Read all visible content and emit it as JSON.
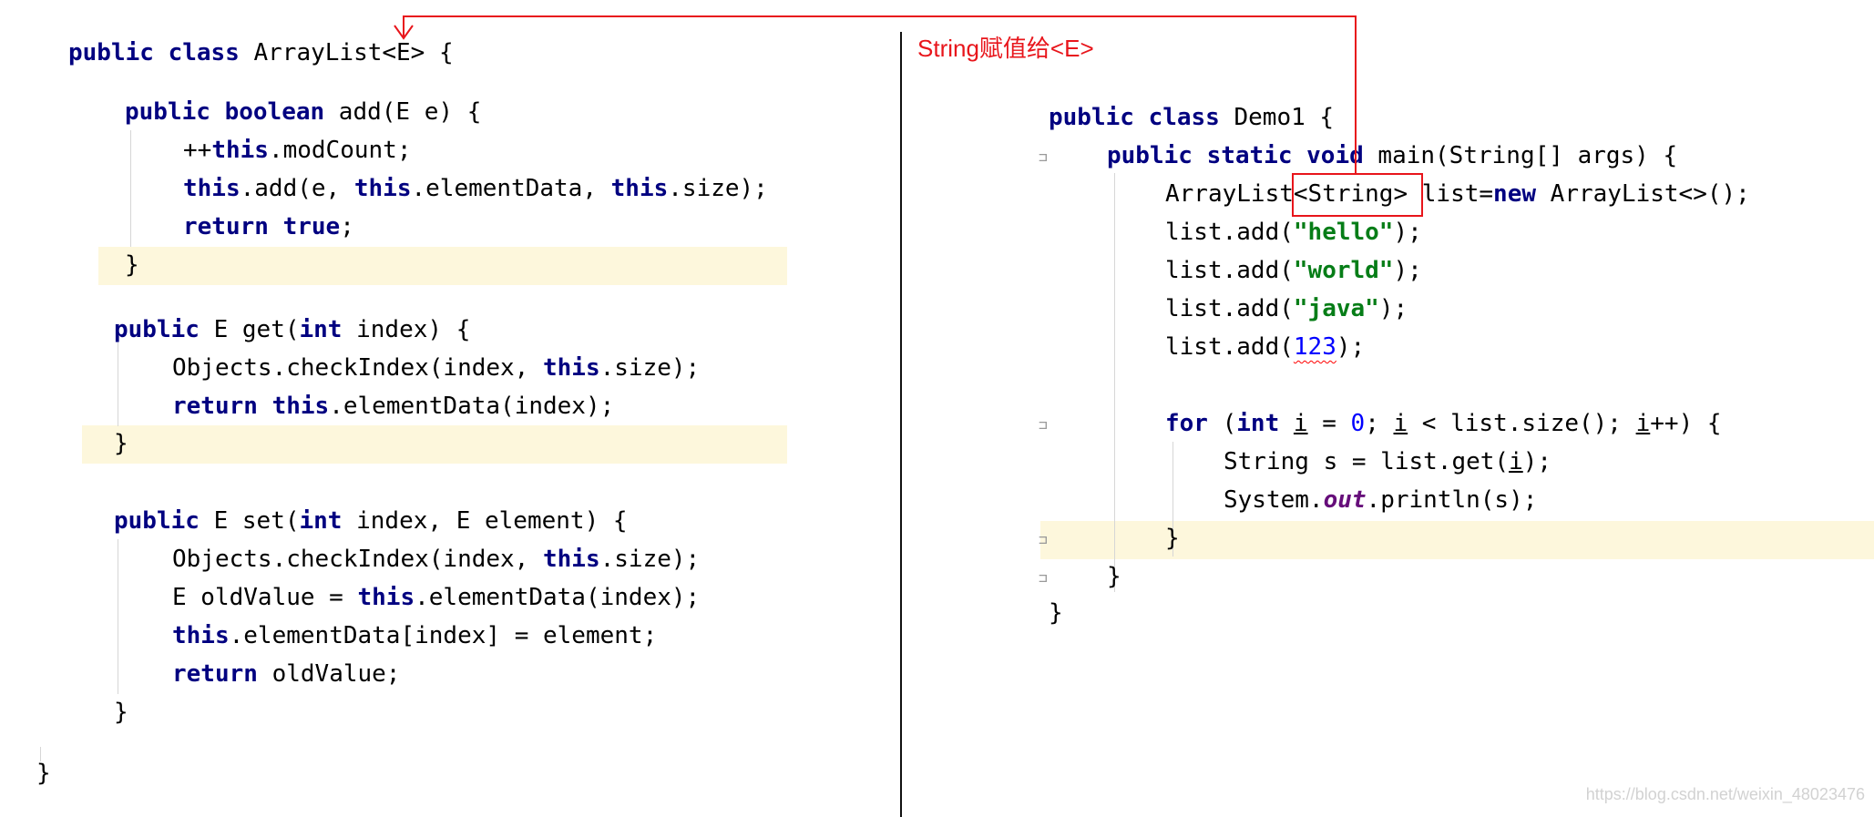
{
  "annotation": {
    "label": "String赋值给<E>",
    "highlight_text": "<String>",
    "arrow_color": "#e8151b"
  },
  "left": {
    "class_decl": {
      "kw": "public class",
      "name": " ArrayList<E> {"
    },
    "add_sig": {
      "kw1": "public",
      "kw2": "boolean",
      "rest": " add(E e) {"
    },
    "add_l1": {
      "pre": "++",
      "kw": "this",
      "post": ".modCount;"
    },
    "add_l2": {
      "kw1": "this",
      "t1": ".add(e, ",
      "kw2": "this",
      "t2": ".elementData, ",
      "kw3": "this",
      "t3": ".size);"
    },
    "add_l3": {
      "kw1": "return",
      "kw2": "true",
      "post": ";"
    },
    "add_close": "}",
    "get_sig": {
      "kw1": "public",
      "t1": " E get(",
      "kw2": "int",
      "t2": " index) {"
    },
    "get_l1": {
      "t1": "Objects.checkIndex(index, ",
      "kw": "this",
      "t2": ".size);"
    },
    "get_l2": {
      "kw1": "return",
      "kw2": "this",
      "t": ".elementData(index);"
    },
    "get_close": "}",
    "set_sig": {
      "kw1": "public",
      "t1": " E set(",
      "kw2": "int",
      "t2": " index, E element) {"
    },
    "set_l1": {
      "t1": "Objects.checkIndex(index, ",
      "kw": "this",
      "t2": ".size);"
    },
    "set_l2": {
      "t1": "E oldValue = ",
      "kw": "this",
      "t2": ".elementData(index);"
    },
    "set_l3": {
      "kw": "this",
      "t": ".elementData[index] = element;"
    },
    "set_l4": {
      "kw": "return",
      "t": " oldValue;"
    },
    "set_close": "}",
    "class_close": "}"
  },
  "right": {
    "class_decl": {
      "kw": "public class",
      "name": " Demo1 {"
    },
    "main_sig": {
      "kw": "public static void",
      "t": " main(String[] args) {"
    },
    "list_decl": {
      "t1": "ArrayList",
      "t2": "<String>",
      "t3": " list=",
      "kw": "new",
      "t4": " ArrayList<>();"
    },
    "add1": {
      "t1": "list.add(",
      "s": "\"hello\"",
      "t2": ");"
    },
    "add2": {
      "t1": "list.add(",
      "s": "\"world\"",
      "t2": ");"
    },
    "add3": {
      "t1": "list.add(",
      "s": "\"java\"",
      "t2": ");"
    },
    "add4": {
      "t1": "list.add(",
      "n": "123",
      "t2": ");"
    },
    "for_line": {
      "kw1": "for",
      "t1": " (",
      "kw2": "int",
      "t2": " ",
      "i1": "i",
      "t3": " = ",
      "n": "0",
      "t4": "; ",
      "i2": "i",
      "t5": " < list.size(); ",
      "i3": "i",
      "t6": "++) {"
    },
    "get_line": {
      "t1": "String s = list.get(",
      "i": "i",
      "t2": ");"
    },
    "print_line": {
      "t1": "System.",
      "f": "out",
      "t2": ".println(s);"
    },
    "for_close": "}",
    "main_close": "}",
    "class_close": "}"
  },
  "watermark": "https://blog.csdn.net/weixin_48023476"
}
